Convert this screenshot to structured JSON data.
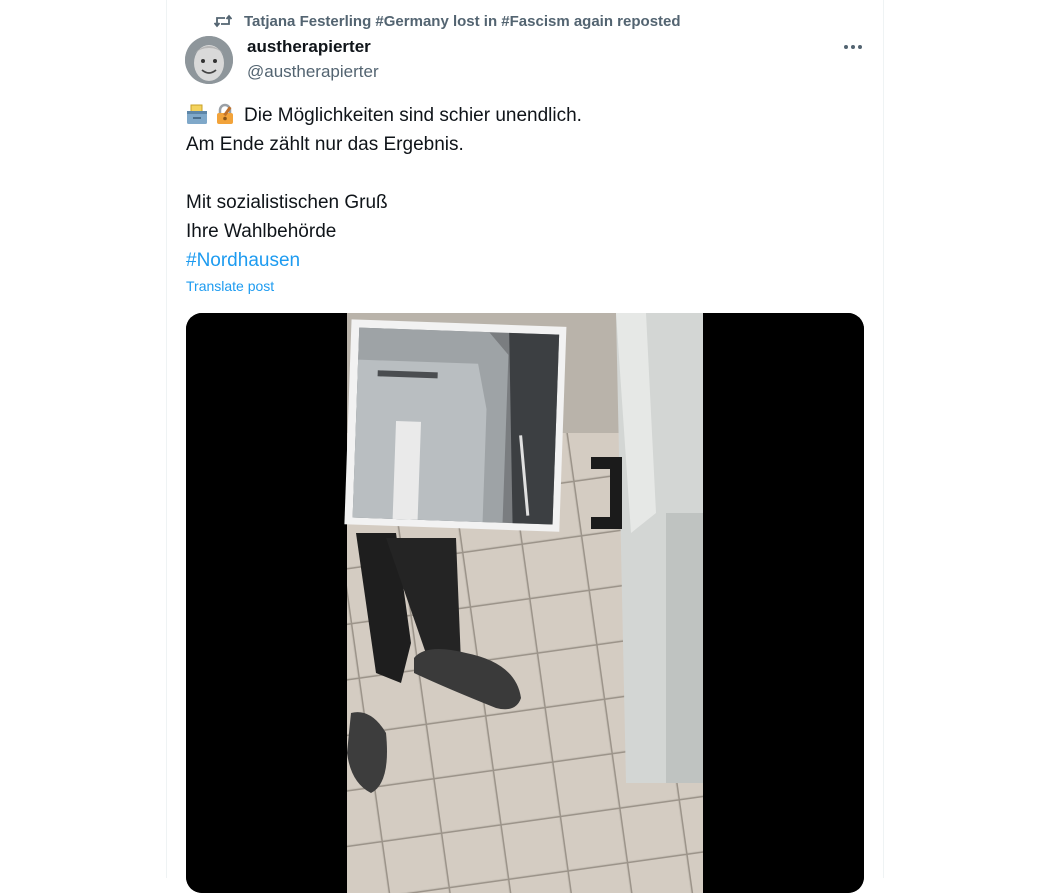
{
  "repost": {
    "text": "Tatjana Festerling #Germany lost in #Fascism again reposted",
    "icon": "repost-icon"
  },
  "author": {
    "display_name": "austherapierter",
    "handle": "@austherapierter"
  },
  "post": {
    "line1_emojis": [
      "ballot-box-emoji",
      "locked-with-key-emoji"
    ],
    "line1": "Die Möglichkeiten sind schier unendlich.",
    "line2": "Am Ende zählt nur das Ergebnis.",
    "line3": "Mit sozialistischen Gruß",
    "line4": "Ihre Wahlbehörde",
    "hashtag": "#Nordhausen",
    "translate_label": "Translate post"
  },
  "colors": {
    "accent": "#1d9bf0",
    "secondary_text": "#536471",
    "primary_text": "#0f1419"
  }
}
